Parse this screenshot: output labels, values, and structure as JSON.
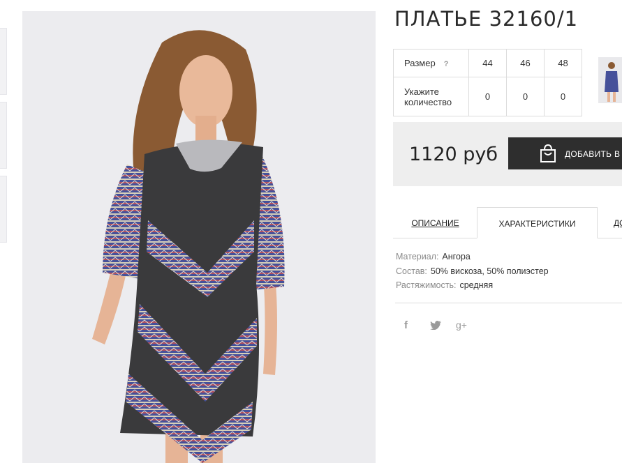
{
  "product": {
    "title": "ПЛАТЬЕ 32160/1"
  },
  "size_table": {
    "size_label": "Размер",
    "help": "?",
    "sizes": [
      "44",
      "46",
      "48"
    ],
    "qty_label": "Укажите количество",
    "quantities": [
      "0",
      "0",
      "0"
    ]
  },
  "purchase": {
    "price": "1120 руб",
    "add_label": "ДОБАВИТЬ В"
  },
  "tabs": {
    "description": "ОПИСАНИЕ",
    "characteristics": "ХАРАКТЕРИСТИКИ",
    "more": "ДО"
  },
  "specs": [
    {
      "key": "Материал:",
      "value": "Ангора"
    },
    {
      "key": "Состав:",
      "value": "50% вискоза, 50% полиэстер"
    },
    {
      "key": "Растяжимость:",
      "value": "средняя"
    }
  ],
  "social": {
    "facebook": "f",
    "twitter": "twitter-icon",
    "google": "g+"
  },
  "colors": {
    "button_bg": "#2e2e2e",
    "buy_box_bg": "#eeeeee",
    "photo_bg": "#ececef",
    "dress_dark": "#3a3a3c",
    "pattern_blue": "#46519a"
  }
}
